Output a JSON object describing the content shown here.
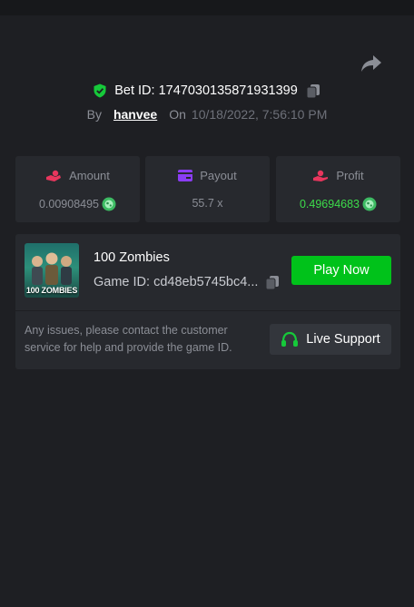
{
  "header": {
    "bet_label": "Bet ID:",
    "bet_id": "1747030135871931399",
    "by_label": "By",
    "username": "hanvee",
    "on_label": "On",
    "datetime": "10/18/2022, 7:56:10 PM"
  },
  "stats": [
    {
      "label": "Amount",
      "value": "0.00908495",
      "icon": "coin-hand-icon"
    },
    {
      "label": "Payout",
      "value": "55.7 x",
      "icon": "card-icon"
    },
    {
      "label": "Profit",
      "value": "0.49694683",
      "icon": "hand-coin-icon"
    }
  ],
  "game": {
    "thumbnail_label": "100 ZOMBIES",
    "name": "100 Zombies",
    "game_id_label": "Game ID:",
    "game_id": "cd48eb5745bc4...",
    "play_label": "Play Now"
  },
  "support": {
    "issues_text": "Any issues, please contact the customer service for help and provide the game ID.",
    "button_label": "Live Support"
  },
  "colors": {
    "background": "#1e1f23",
    "card": "#27292e",
    "accent_green": "#00c21a",
    "profit_green": "#3ddc4b",
    "amount_pink": "#e8365d",
    "payout_purple": "#8b3df5"
  }
}
